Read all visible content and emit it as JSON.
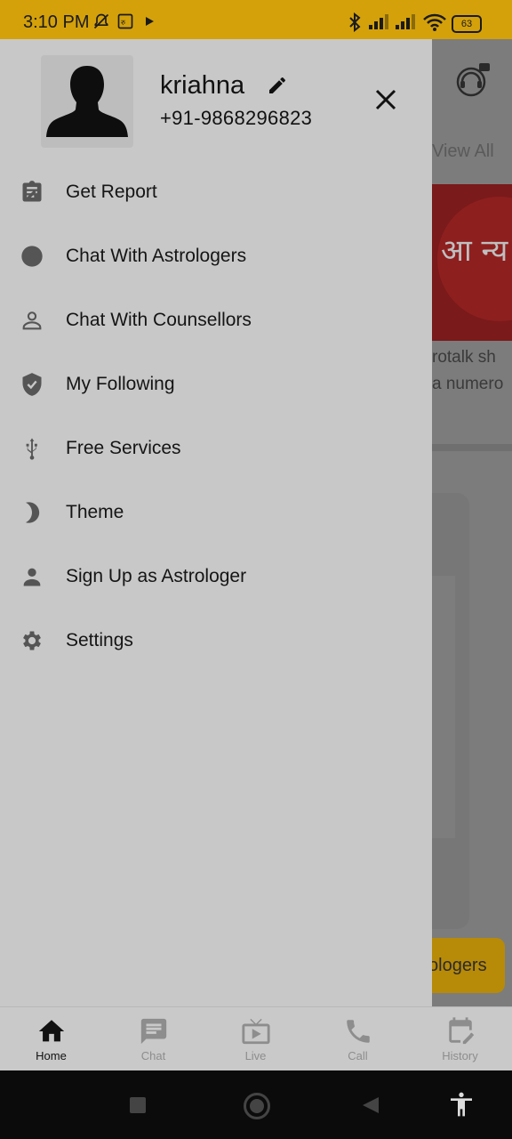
{
  "status_bar": {
    "time": "3:10 PM",
    "battery": "63"
  },
  "background_app": {
    "view_all": "View All",
    "banner_text": "आ न्य",
    "card_line1": "rotalk sh",
    "card_line2": "a numero",
    "button_label": "ologers"
  },
  "drawer": {
    "user": {
      "name": "kriahna",
      "phone": "+91-9868296823"
    },
    "menu": [
      {
        "label": "Get Report",
        "icon": "clipboard-icon"
      },
      {
        "label": "Chat With Astrologers",
        "icon": "circle-icon"
      },
      {
        "label": "Chat With Counsellors",
        "icon": "person-outline-icon"
      },
      {
        "label": "My Following",
        "icon": "shield-check-icon"
      },
      {
        "label": "Free Services",
        "icon": "usb-icon"
      },
      {
        "label": "Theme",
        "icon": "moon-icon"
      },
      {
        "label": "Sign Up as Astrologer",
        "icon": "person-icon"
      },
      {
        "label": "Settings",
        "icon": "gear-icon"
      }
    ]
  },
  "bottom_nav": {
    "items": [
      {
        "label": "Home",
        "icon": "home-icon",
        "active": true
      },
      {
        "label": "Chat",
        "icon": "chat-icon",
        "active": false
      },
      {
        "label": "Live",
        "icon": "live-tv-icon",
        "active": false
      },
      {
        "label": "Call",
        "icon": "phone-icon",
        "active": false
      },
      {
        "label": "History",
        "icon": "calendar-edit-icon",
        "active": false
      }
    ]
  },
  "colors": {
    "status_bar": "#d4a10b",
    "drawer_bg": "#c8c8c8",
    "active_nav": "#111111",
    "inactive_nav": "#8d8d8d"
  }
}
